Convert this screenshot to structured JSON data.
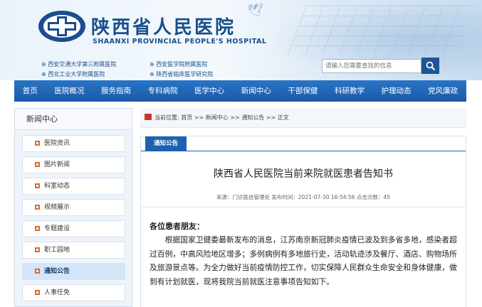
{
  "header": {
    "title": "陕西省人民医院",
    "subtitle": "SHAANXI PROVINCIAL PEOPLE'S HOSPITAL",
    "affiliations": [
      "西安交通大学第三附属医院",
      "西北工业大学附属医院",
      "西安医学院附属医院",
      "陕西省临床医学研究院"
    ],
    "search": {
      "placeholder": "请输入您需要查找的信息"
    }
  },
  "nav": {
    "items": [
      "首页",
      "医院概况",
      "服务指南",
      "专科病院",
      "医学中心",
      "新闻中心",
      "干部保健",
      "科研教学",
      "护理动态",
      "党风廉政"
    ]
  },
  "sidebar": {
    "title": "新闻中心",
    "items": [
      "医院资讯",
      "图片新闻",
      "科室动态",
      "视频展示",
      "专题建设",
      "职工园地",
      "通知公告",
      "人事任免"
    ],
    "active_index": 6
  },
  "breadcrumb": {
    "text": "当前位置: 首页 >> 新闻中心 >> 通知公告 >> 正文"
  },
  "article": {
    "tab": "通知公告",
    "title": "陕西省人民医院当前来院就医患者告知书",
    "meta": "来源：门诊医技管理处 发布时间：2021-07-30 16:54:56    点击次数：45",
    "greeting": "各位患者朋友：",
    "body": "根据国家卫健委最新发布的消息，江苏南京新冠肺炎疫情已波及到多省多地，感染者超过百例，中高风险地区增多；多例病例有多地旅行史，活动轨迹涉及餐厅、酒店、购物场所及旅游景点等。为全力做好当前疫情防控工作，切实保障人民群众生命安全和身体健康，做到有计划就医，现将我院当前就医注意事项告知如下。"
  },
  "colors": {
    "brand": "#1a4e8c",
    "nav": "#1b5aa8",
    "accent_dot": "#e06a2a"
  }
}
